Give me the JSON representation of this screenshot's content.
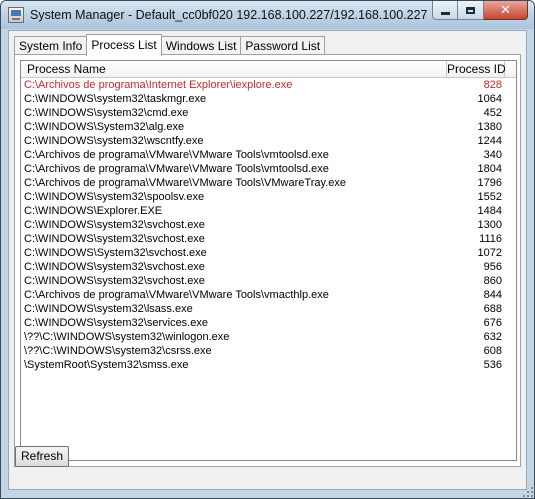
{
  "window": {
    "title": "System Manager - Default_cc0bf020 192.168.100.227/192.168.100.227",
    "icon": "app-window-icon",
    "controls": {
      "minimize": "minimize-icon",
      "maximize": "maximize-icon",
      "close": "close-icon"
    }
  },
  "tabs": [
    {
      "label": "System Info",
      "active": false
    },
    {
      "label": "Process List",
      "active": true
    },
    {
      "label": "Windows List",
      "active": false
    },
    {
      "label": "Password List",
      "active": false
    }
  ],
  "process_list": {
    "columns": {
      "name": "Process Name",
      "pid": "Process ID"
    },
    "highlight_color": "#c62a2a",
    "rows": [
      {
        "name": "C:\\Archivos de programa\\Internet Explorer\\iexplore.exe",
        "pid": "828",
        "highlight": true
      },
      {
        "name": "C:\\WINDOWS\\system32\\taskmgr.exe",
        "pid": "1064"
      },
      {
        "name": "C:\\WINDOWS\\system32\\cmd.exe",
        "pid": "452"
      },
      {
        "name": "C:\\WINDOWS\\System32\\alg.exe",
        "pid": "1380"
      },
      {
        "name": "C:\\WINDOWS\\system32\\wscntfy.exe",
        "pid": "1244"
      },
      {
        "name": "C:\\Archivos de programa\\VMware\\VMware Tools\\vmtoolsd.exe",
        "pid": "340"
      },
      {
        "name": "C:\\Archivos de programa\\VMware\\VMware Tools\\vmtoolsd.exe",
        "pid": "1804"
      },
      {
        "name": "C:\\Archivos de programa\\VMware\\VMware Tools\\VMwareTray.exe",
        "pid": "1796"
      },
      {
        "name": "C:\\WINDOWS\\system32\\spoolsv.exe",
        "pid": "1552"
      },
      {
        "name": "C:\\WINDOWS\\Explorer.EXE",
        "pid": "1484"
      },
      {
        "name": "C:\\WINDOWS\\system32\\svchost.exe",
        "pid": "1300"
      },
      {
        "name": "C:\\WINDOWS\\system32\\svchost.exe",
        "pid": "1116"
      },
      {
        "name": "C:\\WINDOWS\\System32\\svchost.exe",
        "pid": "1072"
      },
      {
        "name": "C:\\WINDOWS\\system32\\svchost.exe",
        "pid": "956"
      },
      {
        "name": "C:\\WINDOWS\\system32\\svchost.exe",
        "pid": "860"
      },
      {
        "name": "C:\\Archivos de programa\\VMware\\VMware Tools\\vmacthlp.exe",
        "pid": "844"
      },
      {
        "name": "C:\\WINDOWS\\system32\\lsass.exe",
        "pid": "688"
      },
      {
        "name": "C:\\WINDOWS\\system32\\services.exe",
        "pid": "676"
      },
      {
        "name": "\\??\\C:\\WINDOWS\\system32\\winlogon.exe",
        "pid": "632"
      },
      {
        "name": "\\??\\C:\\WINDOWS\\system32\\csrss.exe",
        "pid": "608"
      },
      {
        "name": "\\SystemRoot\\System32\\smss.exe",
        "pid": "536"
      }
    ]
  },
  "buttons": {
    "refresh": "Refresh"
  }
}
